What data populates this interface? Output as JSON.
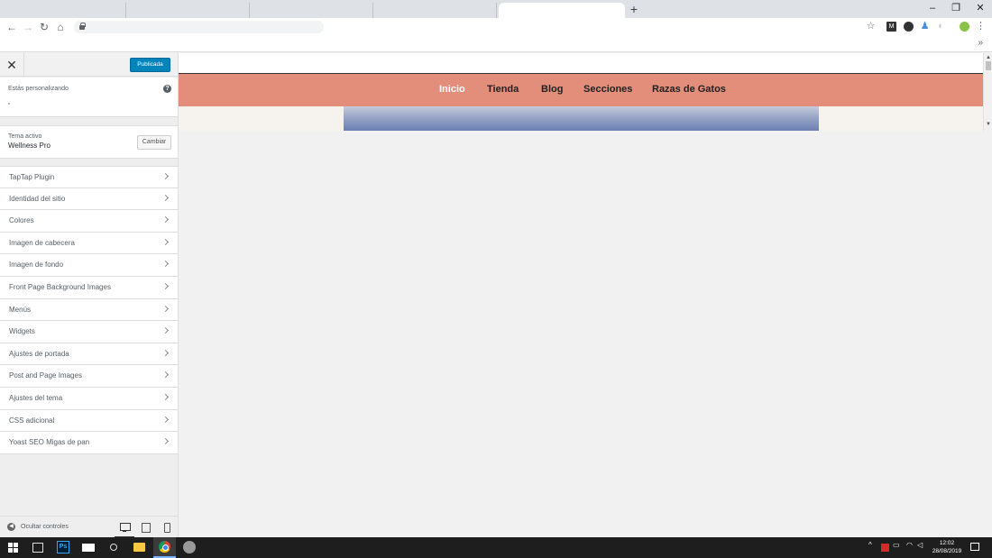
{
  "customizer": {
    "publish_label": "Publicada",
    "customizing_label": "Estás personalizando",
    "active_theme_label": "Tema activo",
    "theme_name": "Wellness Pro",
    "change_label": "Cambiar",
    "menu": [
      {
        "label": "TapTap Plugin"
      },
      {
        "label": "Identidad del sitio"
      },
      {
        "label": "Colores"
      },
      {
        "label": "Imagen de cabecera"
      },
      {
        "label": "Imagen de fondo"
      },
      {
        "label": "Front Page Background Images"
      },
      {
        "label": "Menús"
      },
      {
        "label": "Widgets"
      },
      {
        "label": "Ajustes de portada"
      },
      {
        "label": "Post and Page Images"
      },
      {
        "label": "Ajustes del tema"
      },
      {
        "label": "CSS adicional"
      },
      {
        "label": "Yoast SEO Migas de pan"
      }
    ],
    "hide_controls_label": "Ocultar controles"
  },
  "preview": {
    "nav": [
      {
        "label": "Inicio"
      },
      {
        "label": "Tienda"
      },
      {
        "label": "Blog"
      },
      {
        "label": "Secciones"
      },
      {
        "label": "Razas de Gatos"
      }
    ],
    "nav_color": "#e28e7a",
    "active_link_color": "#ffffff"
  },
  "browser": {
    "bookmarks_more": "»"
  },
  "taskbar": {
    "ps_label": "Ps",
    "time": "12:02",
    "date": "28/08/2019"
  }
}
